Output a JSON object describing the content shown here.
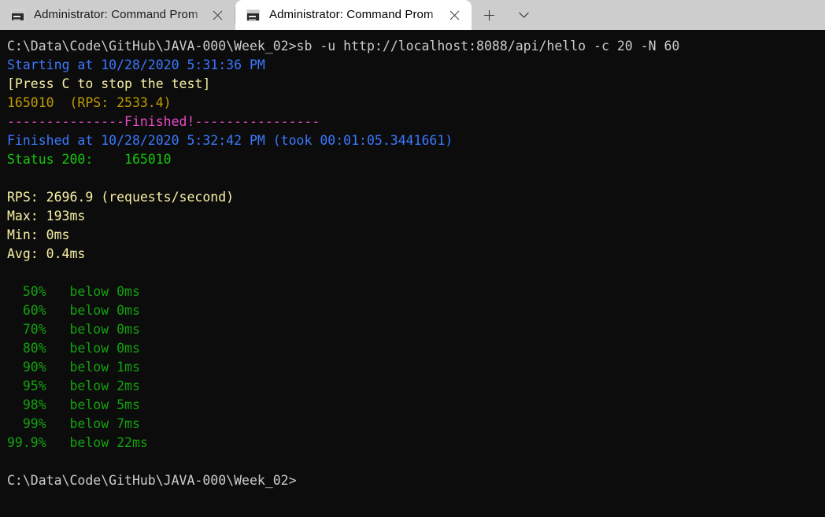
{
  "window": {
    "titlebar_color": "#cdcdcd",
    "tabs": [
      {
        "title": "Administrator: Command Prom",
        "icon": "console-icon",
        "active": false,
        "close_label": "✕"
      },
      {
        "title": "Administrator: Command Prom",
        "icon": "console-icon",
        "active": true,
        "close_label": "✕"
      }
    ],
    "new_tab_label": "+",
    "dropdown_label": "⌄"
  },
  "terminal": {
    "background": "#0c0c0c",
    "colors": {
      "white": "#cccccc",
      "blue": "#3b78ff",
      "bright_yellow": "#f9f1a5",
      "dark_yellow": "#c19c00",
      "magenta": "#e74ac8",
      "bright_green": "#16c60c",
      "green": "#13a10e"
    },
    "lines": [
      {
        "text": "C:\\Data\\Code\\GitHub\\JAVA-000\\Week_02>sb -u http://localhost:8088/api/hello -c 20 -N 60",
        "color": "white"
      },
      {
        "text": "Starting at 10/28/2020 5:31:36 PM",
        "color": "blue"
      },
      {
        "text": "[Press C to stop the test]",
        "color": "bright_yellow"
      },
      {
        "text": "165010  (RPS: 2533.4)",
        "color": "dark_yellow"
      },
      {
        "text": "---------------Finished!----------------",
        "color": "magenta"
      },
      {
        "text": "Finished at 10/28/2020 5:32:42 PM (took 00:01:05.3441661)",
        "color": "blue"
      },
      {
        "text": "Status 200:    165010",
        "color": "bright_green"
      },
      {
        "text": "",
        "color": "white"
      },
      {
        "text": "RPS: 2696.9 (requests/second)",
        "color": "bright_yellow"
      },
      {
        "text": "Max: 193ms",
        "color": "bright_yellow"
      },
      {
        "text": "Min: 0ms",
        "color": "bright_yellow"
      },
      {
        "text": "Avg: 0.4ms",
        "color": "bright_yellow"
      },
      {
        "text": "",
        "color": "white"
      },
      {
        "text": "  50%   below 0ms",
        "color": "green"
      },
      {
        "text": "  60%   below 0ms",
        "color": "green"
      },
      {
        "text": "  70%   below 0ms",
        "color": "green"
      },
      {
        "text": "  80%   below 0ms",
        "color": "green"
      },
      {
        "text": "  90%   below 1ms",
        "color": "green"
      },
      {
        "text": "  95%   below 2ms",
        "color": "green"
      },
      {
        "text": "  98%   below 5ms",
        "color": "green"
      },
      {
        "text": "  99%   below 7ms",
        "color": "green"
      },
      {
        "text": "99.9%   below 22ms",
        "color": "green"
      },
      {
        "text": "",
        "color": "white"
      },
      {
        "text": "C:\\Data\\Code\\GitHub\\JAVA-000\\Week_02>",
        "color": "white"
      }
    ]
  }
}
